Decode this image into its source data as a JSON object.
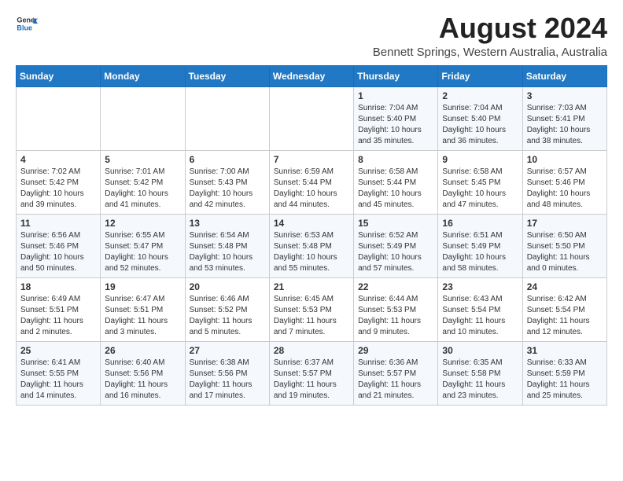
{
  "header": {
    "logo_general": "General",
    "logo_blue": "Blue",
    "month_title": "August 2024",
    "location": "Bennett Springs, Western Australia, Australia"
  },
  "days_of_week": [
    "Sunday",
    "Monday",
    "Tuesday",
    "Wednesday",
    "Thursday",
    "Friday",
    "Saturday"
  ],
  "weeks": [
    [
      {
        "day": "",
        "sunrise": "",
        "sunset": "",
        "daylight": "",
        "empty": true
      },
      {
        "day": "",
        "sunrise": "",
        "sunset": "",
        "daylight": "",
        "empty": true
      },
      {
        "day": "",
        "sunrise": "",
        "sunset": "",
        "daylight": "",
        "empty": true
      },
      {
        "day": "",
        "sunrise": "",
        "sunset": "",
        "daylight": "",
        "empty": true
      },
      {
        "day": "1",
        "sunrise": "Sunrise: 7:04 AM",
        "sunset": "Sunset: 5:40 PM",
        "daylight": "Daylight: 10 hours and 35 minutes.",
        "empty": false
      },
      {
        "day": "2",
        "sunrise": "Sunrise: 7:04 AM",
        "sunset": "Sunset: 5:40 PM",
        "daylight": "Daylight: 10 hours and 36 minutes.",
        "empty": false
      },
      {
        "day": "3",
        "sunrise": "Sunrise: 7:03 AM",
        "sunset": "Sunset: 5:41 PM",
        "daylight": "Daylight: 10 hours and 38 minutes.",
        "empty": false
      }
    ],
    [
      {
        "day": "4",
        "sunrise": "Sunrise: 7:02 AM",
        "sunset": "Sunset: 5:42 PM",
        "daylight": "Daylight: 10 hours and 39 minutes.",
        "empty": false
      },
      {
        "day": "5",
        "sunrise": "Sunrise: 7:01 AM",
        "sunset": "Sunset: 5:42 PM",
        "daylight": "Daylight: 10 hours and 41 minutes.",
        "empty": false
      },
      {
        "day": "6",
        "sunrise": "Sunrise: 7:00 AM",
        "sunset": "Sunset: 5:43 PM",
        "daylight": "Daylight: 10 hours and 42 minutes.",
        "empty": false
      },
      {
        "day": "7",
        "sunrise": "Sunrise: 6:59 AM",
        "sunset": "Sunset: 5:44 PM",
        "daylight": "Daylight: 10 hours and 44 minutes.",
        "empty": false
      },
      {
        "day": "8",
        "sunrise": "Sunrise: 6:58 AM",
        "sunset": "Sunset: 5:44 PM",
        "daylight": "Daylight: 10 hours and 45 minutes.",
        "empty": false
      },
      {
        "day": "9",
        "sunrise": "Sunrise: 6:58 AM",
        "sunset": "Sunset: 5:45 PM",
        "daylight": "Daylight: 10 hours and 47 minutes.",
        "empty": false
      },
      {
        "day": "10",
        "sunrise": "Sunrise: 6:57 AM",
        "sunset": "Sunset: 5:46 PM",
        "daylight": "Daylight: 10 hours and 48 minutes.",
        "empty": false
      }
    ],
    [
      {
        "day": "11",
        "sunrise": "Sunrise: 6:56 AM",
        "sunset": "Sunset: 5:46 PM",
        "daylight": "Daylight: 10 hours and 50 minutes.",
        "empty": false
      },
      {
        "day": "12",
        "sunrise": "Sunrise: 6:55 AM",
        "sunset": "Sunset: 5:47 PM",
        "daylight": "Daylight: 10 hours and 52 minutes.",
        "empty": false
      },
      {
        "day": "13",
        "sunrise": "Sunrise: 6:54 AM",
        "sunset": "Sunset: 5:48 PM",
        "daylight": "Daylight: 10 hours and 53 minutes.",
        "empty": false
      },
      {
        "day": "14",
        "sunrise": "Sunrise: 6:53 AM",
        "sunset": "Sunset: 5:48 PM",
        "daylight": "Daylight: 10 hours and 55 minutes.",
        "empty": false
      },
      {
        "day": "15",
        "sunrise": "Sunrise: 6:52 AM",
        "sunset": "Sunset: 5:49 PM",
        "daylight": "Daylight: 10 hours and 57 minutes.",
        "empty": false
      },
      {
        "day": "16",
        "sunrise": "Sunrise: 6:51 AM",
        "sunset": "Sunset: 5:49 PM",
        "daylight": "Daylight: 10 hours and 58 minutes.",
        "empty": false
      },
      {
        "day": "17",
        "sunrise": "Sunrise: 6:50 AM",
        "sunset": "Sunset: 5:50 PM",
        "daylight": "Daylight: 11 hours and 0 minutes.",
        "empty": false
      }
    ],
    [
      {
        "day": "18",
        "sunrise": "Sunrise: 6:49 AM",
        "sunset": "Sunset: 5:51 PM",
        "daylight": "Daylight: 11 hours and 2 minutes.",
        "empty": false
      },
      {
        "day": "19",
        "sunrise": "Sunrise: 6:47 AM",
        "sunset": "Sunset: 5:51 PM",
        "daylight": "Daylight: 11 hours and 3 minutes.",
        "empty": false
      },
      {
        "day": "20",
        "sunrise": "Sunrise: 6:46 AM",
        "sunset": "Sunset: 5:52 PM",
        "daylight": "Daylight: 11 hours and 5 minutes.",
        "empty": false
      },
      {
        "day": "21",
        "sunrise": "Sunrise: 6:45 AM",
        "sunset": "Sunset: 5:53 PM",
        "daylight": "Daylight: 11 hours and 7 minutes.",
        "empty": false
      },
      {
        "day": "22",
        "sunrise": "Sunrise: 6:44 AM",
        "sunset": "Sunset: 5:53 PM",
        "daylight": "Daylight: 11 hours and 9 minutes.",
        "empty": false
      },
      {
        "day": "23",
        "sunrise": "Sunrise: 6:43 AM",
        "sunset": "Sunset: 5:54 PM",
        "daylight": "Daylight: 11 hours and 10 minutes.",
        "empty": false
      },
      {
        "day": "24",
        "sunrise": "Sunrise: 6:42 AM",
        "sunset": "Sunset: 5:54 PM",
        "daylight": "Daylight: 11 hours and 12 minutes.",
        "empty": false
      }
    ],
    [
      {
        "day": "25",
        "sunrise": "Sunrise: 6:41 AM",
        "sunset": "Sunset: 5:55 PM",
        "daylight": "Daylight: 11 hours and 14 minutes.",
        "empty": false
      },
      {
        "day": "26",
        "sunrise": "Sunrise: 6:40 AM",
        "sunset": "Sunset: 5:56 PM",
        "daylight": "Daylight: 11 hours and 16 minutes.",
        "empty": false
      },
      {
        "day": "27",
        "sunrise": "Sunrise: 6:38 AM",
        "sunset": "Sunset: 5:56 PM",
        "daylight": "Daylight: 11 hours and 17 minutes.",
        "empty": false
      },
      {
        "day": "28",
        "sunrise": "Sunrise: 6:37 AM",
        "sunset": "Sunset: 5:57 PM",
        "daylight": "Daylight: 11 hours and 19 minutes.",
        "empty": false
      },
      {
        "day": "29",
        "sunrise": "Sunrise: 6:36 AM",
        "sunset": "Sunset: 5:57 PM",
        "daylight": "Daylight: 11 hours and 21 minutes.",
        "empty": false
      },
      {
        "day": "30",
        "sunrise": "Sunrise: 6:35 AM",
        "sunset": "Sunset: 5:58 PM",
        "daylight": "Daylight: 11 hours and 23 minutes.",
        "empty": false
      },
      {
        "day": "31",
        "sunrise": "Sunrise: 6:33 AM",
        "sunset": "Sunset: 5:59 PM",
        "daylight": "Daylight: 11 hours and 25 minutes.",
        "empty": false
      }
    ]
  ]
}
